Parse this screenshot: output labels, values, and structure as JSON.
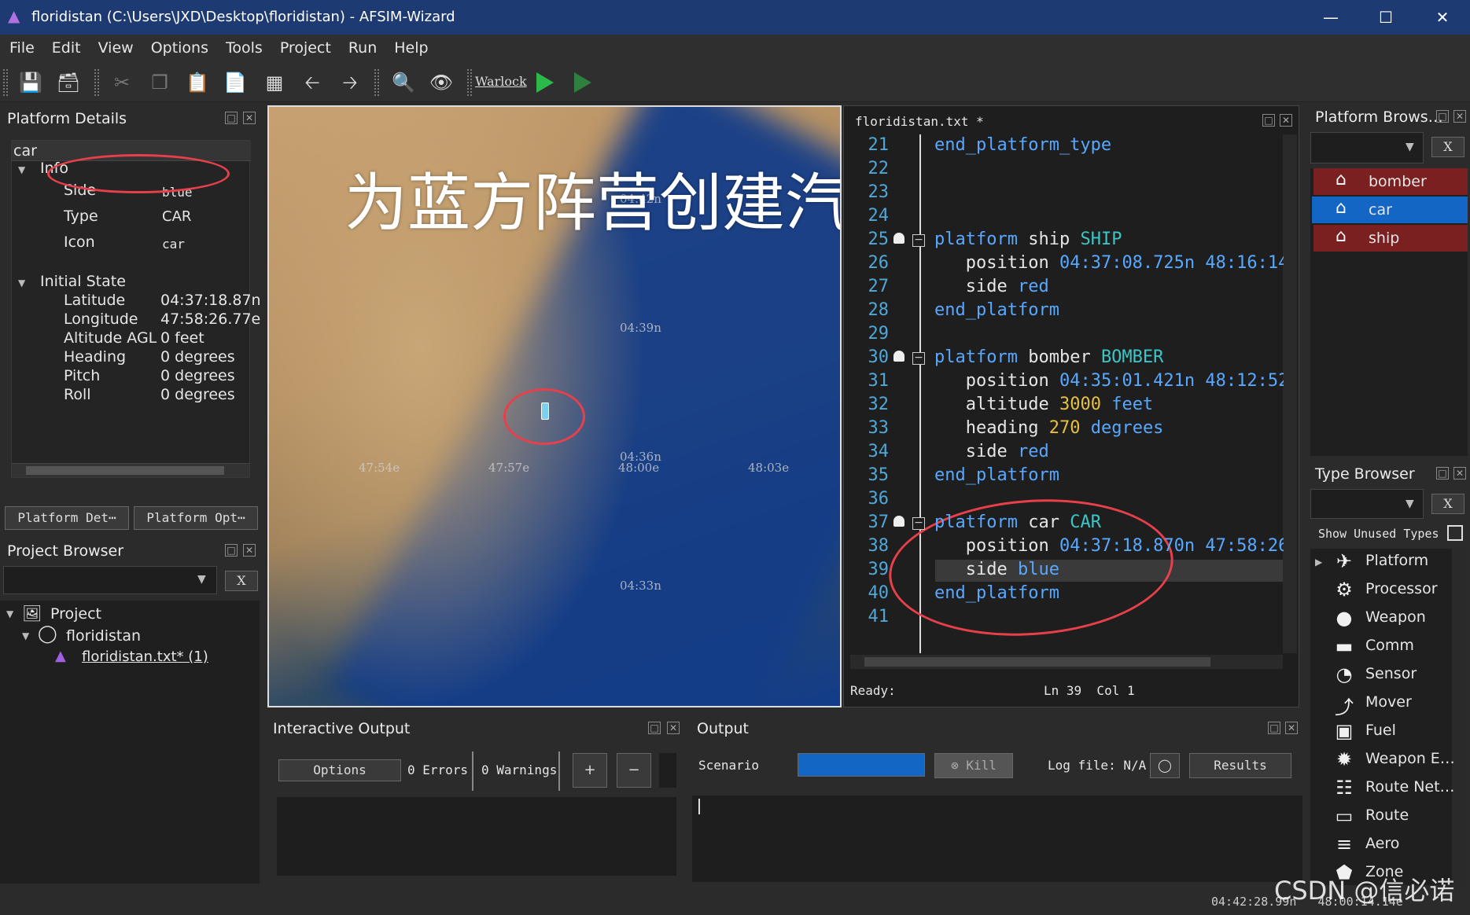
{
  "window": {
    "title": "floridistan (C:\\Users\\JXD\\Desktop\\floridistan) - AFSIM-Wizard"
  },
  "menu": [
    "File",
    "Edit",
    "View",
    "Options",
    "Tools",
    "Project",
    "Run",
    "Help"
  ],
  "toolbar": {
    "warlock_label": "Warlock"
  },
  "platform_details": {
    "title": "Platform Details",
    "name": "car",
    "info_label": "Info",
    "side_label": "Side",
    "side_value": "blue",
    "type_label": "Type",
    "type_value": "CAR",
    "icon_label": "Icon",
    "icon_value": "car",
    "initial_state_label": "Initial State",
    "rows": [
      {
        "label": "Latitude",
        "value": "04:37:18.87n"
      },
      {
        "label": "Longitude",
        "value": "47:58:26.77e"
      },
      {
        "label": "Altitude AGL",
        "value": "0 feet"
      },
      {
        "label": "Heading",
        "value": "0 degrees"
      },
      {
        "label": "Pitch",
        "value": "0 degrees"
      },
      {
        "label": "Roll",
        "value": "0 degrees"
      }
    ],
    "tab1": "Platform Det⋯",
    "tab2": "Platform Opt⋯"
  },
  "project_browser": {
    "title": "Project Browser",
    "clear": "X",
    "root": "Project",
    "folder": "floridistan",
    "file": "floridistan.txt* (1)"
  },
  "map": {
    "overlay": "为蓝方阵营创建汽车",
    "labels": {
      "n42": "04:42n",
      "n39": "04:39n",
      "n36": "04:36n",
      "n33": "04:33n",
      "e54": "47:54e",
      "e57": "47:57e",
      "e00": "48:00e",
      "e03": "48:03e"
    }
  },
  "editor": {
    "tab": "floridistan.txt *",
    "status_ready": "Ready:",
    "status_pos": "Ln 39  Col 1",
    "lines": [
      {
        "n": "21",
        "t": "end_platform_type"
      },
      {
        "n": "22",
        "t": ""
      },
      {
        "n": "23",
        "t": ""
      },
      {
        "n": "24",
        "t": ""
      },
      {
        "n": "25",
        "a": "platform ship ",
        "b": "SHIP"
      },
      {
        "n": "26",
        "a": "   position ",
        "c": "04:37:08.725n 48:16:14"
      },
      {
        "n": "27",
        "a": "   side ",
        "d": "red"
      },
      {
        "n": "28",
        "t": "end_platform"
      },
      {
        "n": "29",
        "t": ""
      },
      {
        "n": "30",
        "a": "platform bomber ",
        "b": "BOMBER"
      },
      {
        "n": "31",
        "a": "   position ",
        "c": "04:35:01.421n 48:12:52"
      },
      {
        "n": "32",
        "a": "   altitude ",
        "e": "3000",
        "f": " feet"
      },
      {
        "n": "33",
        "a": "   heading ",
        "e": "270",
        "f": " degrees"
      },
      {
        "n": "34",
        "a": "   side ",
        "d": "red"
      },
      {
        "n": "35",
        "t": "end_platform"
      },
      {
        "n": "36",
        "t": ""
      },
      {
        "n": "37",
        "a": "platform car ",
        "b": "CAR"
      },
      {
        "n": "38",
        "a": "   position ",
        "c": "04:37:18.870n 47:58:26"
      },
      {
        "n": "39",
        "a": "   side ",
        "d": "blue"
      },
      {
        "n": "40",
        "t": "end_platform"
      },
      {
        "n": "41",
        "t": ""
      }
    ]
  },
  "platform_browser": {
    "title": "Platform Brows…",
    "clear": "X",
    "items": [
      "bomber",
      "car",
      "ship"
    ],
    "colors": {
      "red": "#7a2020",
      "selected": "#1466c4"
    }
  },
  "type_browser": {
    "title": "Type Browser",
    "clear": "X",
    "show_unused": "Show Unused Types",
    "items": [
      {
        "label": "Platform",
        "icon": "jet-icon"
      },
      {
        "label": "Processor",
        "icon": "gears-icon"
      },
      {
        "label": "Weapon",
        "icon": "bomb-icon"
      },
      {
        "label": "Comm",
        "icon": "speech-bubble-icon"
      },
      {
        "label": "Sensor",
        "icon": "radar-dish-icon"
      },
      {
        "label": "Mover",
        "icon": "bird-icon"
      },
      {
        "label": "Fuel",
        "icon": "fuel-pump-icon"
      },
      {
        "label": "Weapon E…",
        "icon": "explosion-icon"
      },
      {
        "label": "Route Net…",
        "icon": "network-icon"
      },
      {
        "label": "Route",
        "icon": "signpost-icon"
      },
      {
        "label": "Aero",
        "icon": "wing-icon"
      },
      {
        "label": "Zone",
        "icon": "pentagon-icon"
      }
    ]
  },
  "interactive_output": {
    "title": "Interactive Output",
    "options": "Options",
    "errors": "0 Errors",
    "warnings": "0 Warnings",
    "plus": "+",
    "minus": "−"
  },
  "output": {
    "title": "Output",
    "scenario": "Scenario",
    "kill": "Kill",
    "log_file": "Log file: N/A",
    "results": "Results"
  },
  "statusbar": {
    "coords": "04:42:28.99n   48:00:14.14e"
  },
  "watermark": "CSDN @信必诺"
}
